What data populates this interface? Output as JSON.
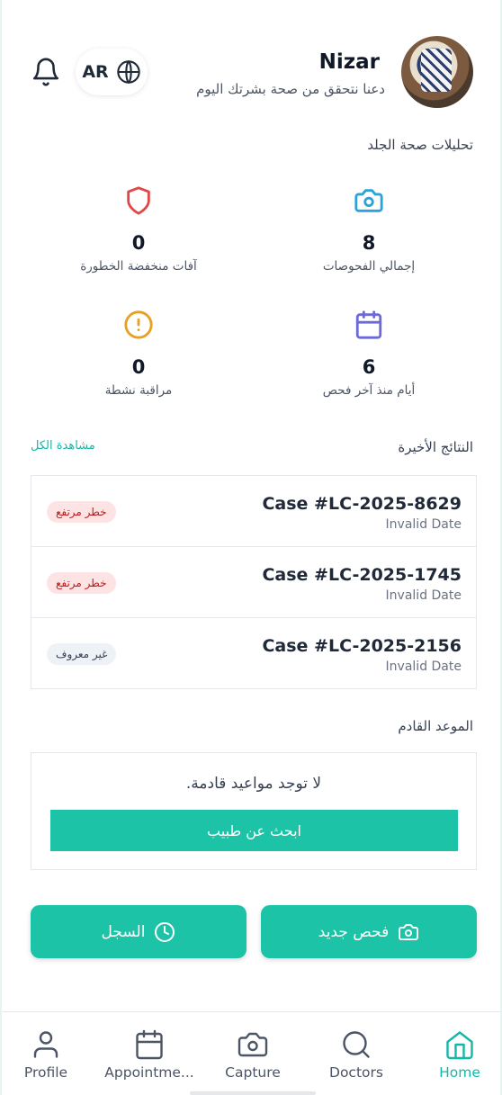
{
  "header": {
    "user_name": "Nizar",
    "greeting": "دعنا نتحقق من صحة بشرتك اليوم",
    "language": "AR",
    "icons": [
      "bell-icon",
      "globe-icon"
    ]
  },
  "stats": {
    "section_title": "تحليلات صحة الجلد",
    "items": [
      {
        "value": "8",
        "label": "إجمالي الفحوصات",
        "icon": "camera-icon",
        "color": "#2aa3d8"
      },
      {
        "value": "0",
        "label": "آفات منخفضة الخطورة",
        "icon": "shield-icon",
        "color": "#e04848"
      },
      {
        "value": "6",
        "label": "أيام منذ آخر فحص",
        "icon": "calendar-icon",
        "color": "#6d6ad8"
      },
      {
        "value": "0",
        "label": "مراقبة نشطة",
        "icon": "alert-circle-icon",
        "color": "#e8a020"
      }
    ]
  },
  "results": {
    "title": "النتائج الأخيرة",
    "view_all": "مشاهدة الكل",
    "items": [
      {
        "case": "Case #LC-2025-8629",
        "date": "Invalid Date",
        "badge": "خطر مرتفع"
      },
      {
        "case": "Case #LC-2025-1745",
        "date": "Invalid Date",
        "badge": "خطر مرتفع"
      },
      {
        "case": "Case #LC-2025-2156",
        "date": "Invalid Date",
        "badge": "غير معروف"
      }
    ]
  },
  "appointment": {
    "title": "الموعد القادم",
    "empty_message": "لا توجد مواعيد قادمة.",
    "find_doctor": "ابحث عن طبيب"
  },
  "actions": {
    "new_scan": "فحص جديد",
    "history": "السجل"
  },
  "nav": {
    "items": [
      {
        "label": "Profile",
        "icon": "person-icon"
      },
      {
        "label": "Appointme...",
        "icon": "calendar-icon"
      },
      {
        "label": "Capture",
        "icon": "camera-icon"
      },
      {
        "label": "Doctors",
        "icon": "search-icon"
      },
      {
        "label": "Home",
        "icon": "home-icon",
        "active": true
      }
    ],
    "active_color": "#14b8a6"
  },
  "colors": {
    "accent": "#1cc3a6",
    "high_risk_bg": "#fde3e3",
    "unknown_bg": "#eef2f7"
  }
}
